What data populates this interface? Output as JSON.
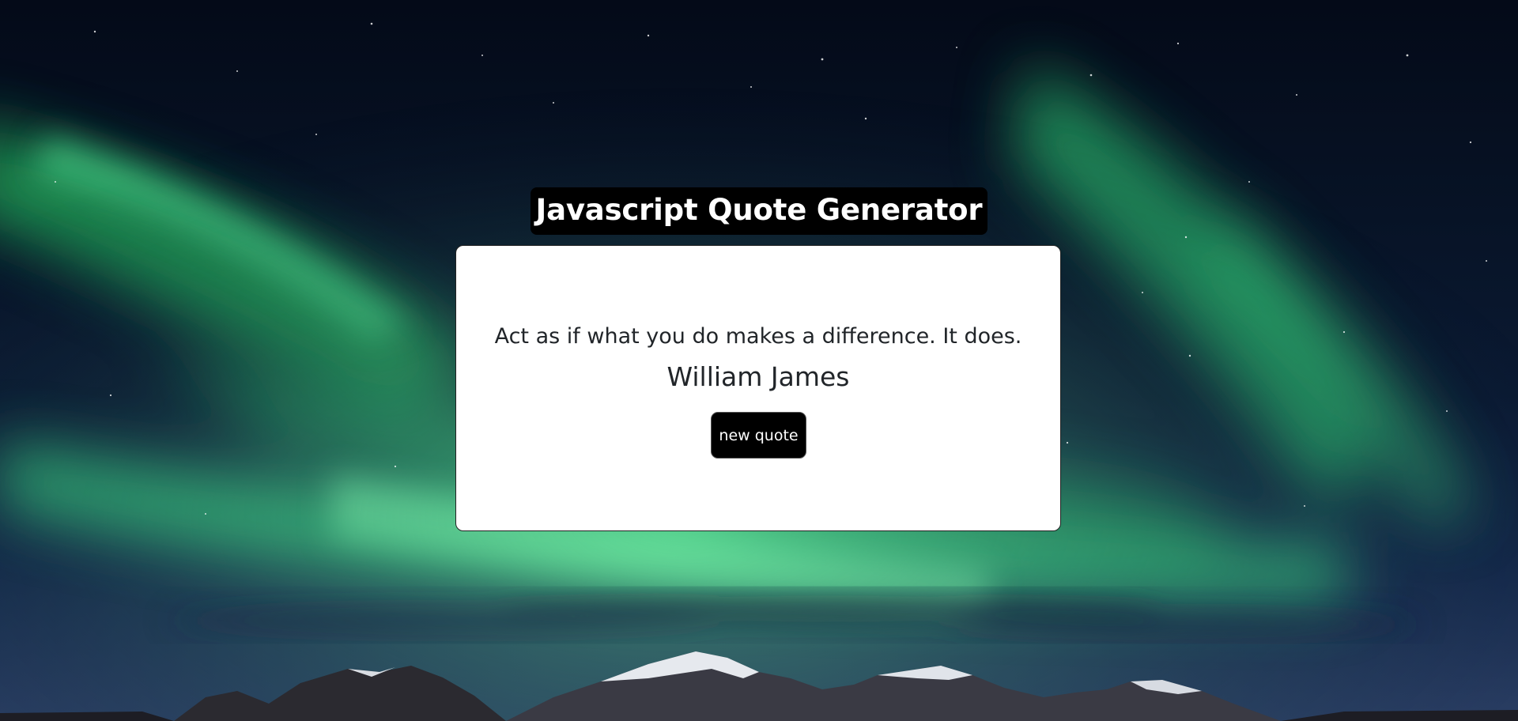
{
  "header": {
    "title": "Javascript Quote Generator"
  },
  "quote": {
    "text": "Act as if what you do makes a difference. It does.",
    "author": "William James",
    "button_label": "new quote"
  },
  "colors": {
    "title_bg": "#000000",
    "card_bg": "#ffffff",
    "button_bg": "#000000",
    "text": "#212529"
  }
}
